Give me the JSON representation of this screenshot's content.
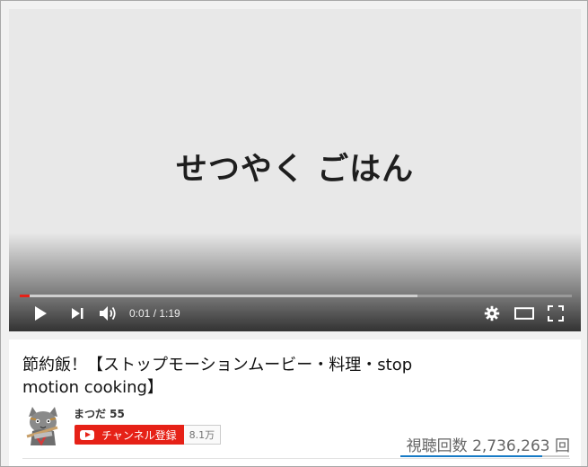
{
  "player": {
    "overlay_text": "せつやく ごはん",
    "time_current": "0:01",
    "time_separator": " / ",
    "time_total": "1:19",
    "progress_played_fraction": 0.018,
    "progress_buffered_fraction": 0.72,
    "colors": {
      "played": "#e62117"
    },
    "icons": [
      "play-icon",
      "next-icon",
      "volume-icon",
      "settings-icon",
      "theater-mode-icon",
      "fullscreen-icon"
    ]
  },
  "video": {
    "title": "節約飯！【ストップモーションムービー・料理・stop motion cooking】"
  },
  "channel": {
    "name": "まつだ 55",
    "subscribe_label": "チャンネル登録",
    "subscriber_count": "8.1万"
  },
  "stats": {
    "views": "視聴回数 2,736,263 回",
    "like_ratio_fraction": 0.84
  }
}
